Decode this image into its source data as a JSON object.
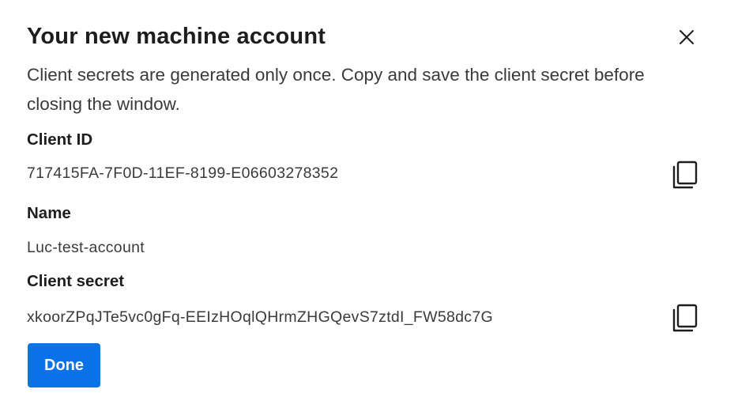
{
  "dialog": {
    "title": "Your new machine account",
    "description": "Client secrets are generated only once. Copy and save the client secret before closing the window.",
    "fields": [
      {
        "label": "Client ID",
        "value": "717415FA-7F0D-11EF-8199-E06603278352"
      },
      {
        "label": "Name",
        "value": "Luc-test-account"
      },
      {
        "label": "Client secret",
        "value": "xkoorZPqJTe5vc0gFq-EEIzHOqlQHrmZHGQevS7ztdI_FW58dc7G"
      }
    ],
    "done_label": "Done",
    "icons": {
      "close": "close-icon",
      "copy": "copy-icon"
    },
    "colors": {
      "primary": "#0a72e8",
      "text": "#1d1d1f",
      "muted_text": "#3a3a3c"
    }
  }
}
